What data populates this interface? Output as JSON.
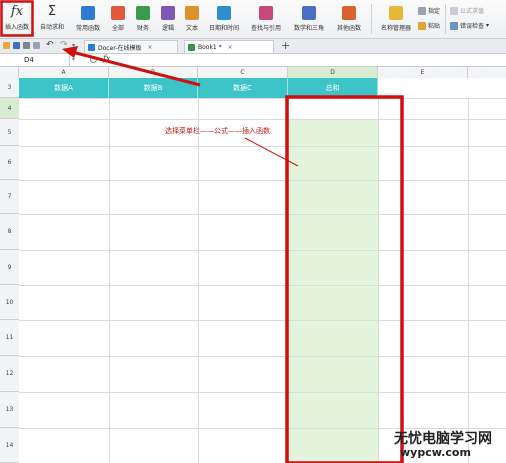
{
  "ribbon": {
    "insert_function": "插入函数",
    "fx_symbol": "fx",
    "autosum": "自动求和",
    "sigma": "Σ",
    "buttons": [
      "常用函数",
      "全部",
      "财务",
      "逻辑",
      "文本",
      "日期和时间",
      "查找与引用",
      "数学和三角",
      "其他函数"
    ],
    "name_manager": "名称管理器",
    "specify": "指定",
    "paste": "粘贴",
    "formula_eval": "公式求值",
    "error_check": "错误检查"
  },
  "tabs": [
    {
      "label": "Docer-在线模板"
    },
    {
      "label": "Book1 *"
    }
  ],
  "formula_bar": {
    "cell_ref": "D4",
    "fx": "fx"
  },
  "columns": [
    "A",
    "B",
    "C",
    "D",
    "E"
  ],
  "rows": [
    "3",
    "4",
    "5",
    "6",
    "7",
    "8",
    "9",
    "10",
    "11",
    "12",
    "13",
    "14"
  ],
  "header_cells": [
    "数据A",
    "数据B",
    "数据C",
    "总和"
  ],
  "annotation": "选择菜单栏——公式——插入函数",
  "watermark": {
    "line1": "无忧电脑学习网",
    "line2": "wypcw.com"
  },
  "colors": {
    "header_teal": "#3cc4c8",
    "selected_col": "#e2f4dc",
    "annotation_red": "#d01010"
  }
}
